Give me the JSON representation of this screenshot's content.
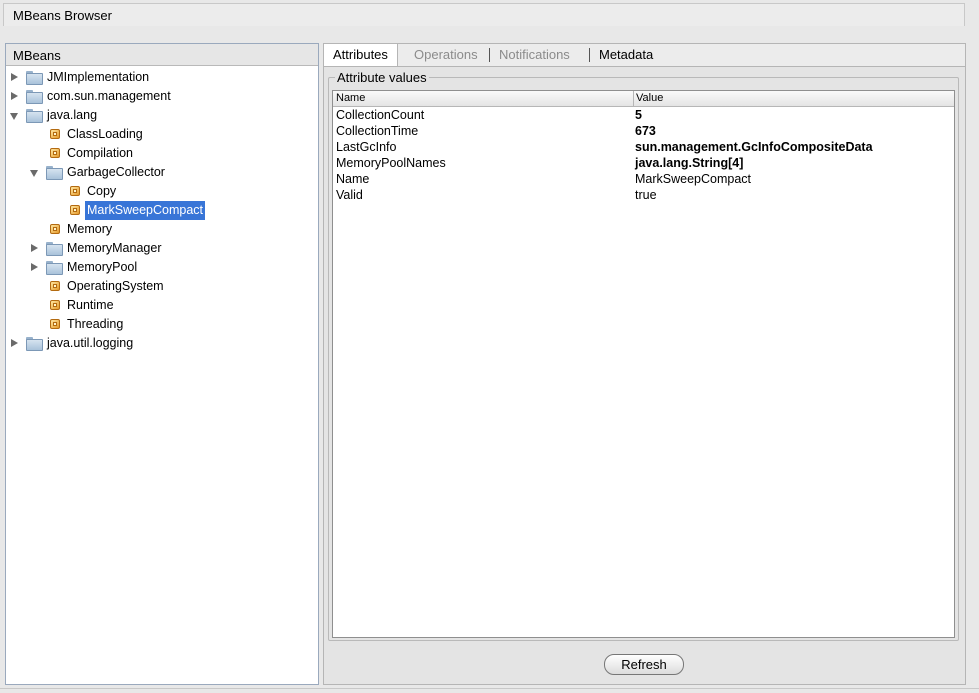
{
  "window": {
    "title": "MBeans Browser"
  },
  "mbeans": {
    "header": "MBeans",
    "tree": [
      {
        "label": "JMImplementation",
        "kind": "folder",
        "state": "collapsed",
        "depth": 0
      },
      {
        "label": "com.sun.management",
        "kind": "folder",
        "state": "collapsed",
        "depth": 0
      },
      {
        "label": "java.lang",
        "kind": "folder",
        "state": "expanded",
        "depth": 0
      },
      {
        "label": "ClassLoading",
        "kind": "bean",
        "state": "leaf",
        "depth": 1
      },
      {
        "label": "Compilation",
        "kind": "bean",
        "state": "leaf",
        "depth": 1
      },
      {
        "label": "GarbageCollector",
        "kind": "folder",
        "state": "expanded",
        "depth": 1
      },
      {
        "label": "Copy",
        "kind": "bean",
        "state": "leaf",
        "depth": 2
      },
      {
        "label": "MarkSweepCompact",
        "kind": "bean",
        "state": "leaf",
        "depth": 2,
        "selected": true
      },
      {
        "label": "Memory",
        "kind": "bean",
        "state": "leaf",
        "depth": 1
      },
      {
        "label": "MemoryManager",
        "kind": "folder",
        "state": "collapsed",
        "depth": 1
      },
      {
        "label": "MemoryPool",
        "kind": "folder",
        "state": "collapsed",
        "depth": 1
      },
      {
        "label": "OperatingSystem",
        "kind": "bean",
        "state": "leaf",
        "depth": 1
      },
      {
        "label": "Runtime",
        "kind": "bean",
        "state": "leaf",
        "depth": 1
      },
      {
        "label": "Threading",
        "kind": "bean",
        "state": "leaf",
        "depth": 1
      },
      {
        "label": "java.util.logging",
        "kind": "folder",
        "state": "collapsed",
        "depth": 0
      }
    ]
  },
  "tabs": [
    {
      "label": "Attributes",
      "state": "active"
    },
    {
      "label": "Operations",
      "state": "disabled"
    },
    {
      "label": "Notifications",
      "state": "disabled"
    },
    {
      "label": "Metadata",
      "state": "enabled"
    }
  ],
  "attributes": {
    "group_label": "Attribute values",
    "columns": [
      "Name",
      "Value"
    ],
    "rows": [
      {
        "name": "CollectionCount",
        "value": "5",
        "bold": true
      },
      {
        "name": "CollectionTime",
        "value": "673",
        "bold": true
      },
      {
        "name": "LastGcInfo",
        "value": "sun.management.GcInfoCompositeData",
        "bold": true
      },
      {
        "name": "MemoryPoolNames",
        "value": "java.lang.String[4]",
        "bold": true
      },
      {
        "name": "Name",
        "value": "MarkSweepCompact",
        "bold": false
      },
      {
        "name": "Valid",
        "value": "true",
        "bold": false
      }
    ]
  },
  "buttons": {
    "refresh": "Refresh"
  },
  "colors": {
    "selection": "#3875d7",
    "tree_border": "#9aa9bd"
  }
}
